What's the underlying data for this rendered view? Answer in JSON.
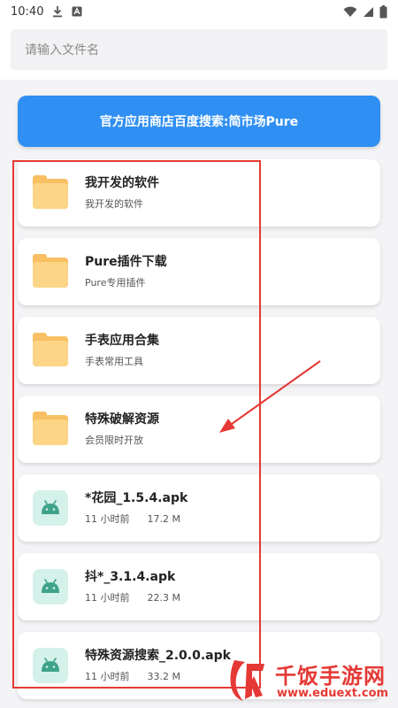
{
  "status_bar": {
    "time": "10:40",
    "left_icons": [
      "download-icon",
      "a-box-icon"
    ],
    "right_icons": [
      "wifi-icon",
      "signal-icon",
      "battery-icon"
    ]
  },
  "search": {
    "placeholder": "请输入文件名"
  },
  "banner": {
    "text": "官方应用商店百度搜索:简市场Pure",
    "color": "#2f8ff3"
  },
  "files": [
    {
      "type": "folder",
      "title": "我开发的软件",
      "subtitle": "我开发的软件"
    },
    {
      "type": "folder",
      "title": "Pure插件下载",
      "subtitle": "Pure专用插件"
    },
    {
      "type": "folder",
      "title": "手表应用合集",
      "subtitle": "手表常用工具"
    },
    {
      "type": "folder",
      "title": "特殊破解资源",
      "subtitle": "会员限时开放"
    },
    {
      "type": "apk",
      "title": "*花园_1.5.4.apk",
      "time": "11 小时前",
      "size": "17.2 M"
    },
    {
      "type": "apk",
      "title": "抖*_3.1.4.apk",
      "time": "11 小时前",
      "size": "22.3 M"
    },
    {
      "type": "apk",
      "title": "特殊资源搜索_2.0.0.apk",
      "time": "11 小时前",
      "size": "33.2 M"
    }
  ],
  "watermark": {
    "name": "千饭手游网",
    "url": "www.eduext.com",
    "color": "#e53935"
  }
}
